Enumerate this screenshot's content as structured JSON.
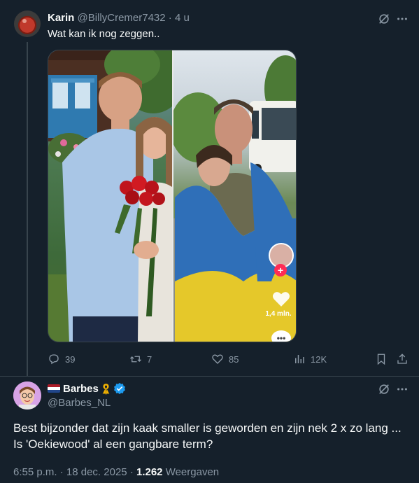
{
  "tweet1": {
    "author_name": "Karin",
    "author_handle": "@BillyCremer7432",
    "time_sep": "·",
    "time": "4 u",
    "text": "Wat kan ik nog zeggen..",
    "media": {
      "tiktok_like_count": "1,4 mln."
    },
    "actions": {
      "replies": "39",
      "reposts": "7",
      "likes": "85",
      "views": "12K"
    }
  },
  "tweet2": {
    "author_name": "Barbes",
    "author_handle": "@Barbes_NL",
    "text_line1": "Best bijzonder dat zijn kaak smaller is geworden en zijn nek 2 x zo lang ...",
    "text_line2": "Is 'Oekiewood' al een gangbare term?",
    "time": "6:55 p.m.",
    "date_sep": "·",
    "date": "18 dec. 2025",
    "views_sep": "·",
    "views_count": "1.262",
    "views_label": "Weergaven"
  },
  "colors": {
    "background": "#15202b",
    "text": "#f7f9f9",
    "muted": "#8b98a5",
    "border": "#38444d",
    "verified": "#1d9bf0",
    "tiktok_plus": "#fe2c55"
  },
  "icons": [
    "grok-icon",
    "more-icon",
    "reply-icon",
    "repost-icon",
    "like-icon",
    "views-icon",
    "bookmark-icon",
    "share-icon",
    "verified-badge-icon",
    "ribbon-icon",
    "flag-nl-icon"
  ]
}
